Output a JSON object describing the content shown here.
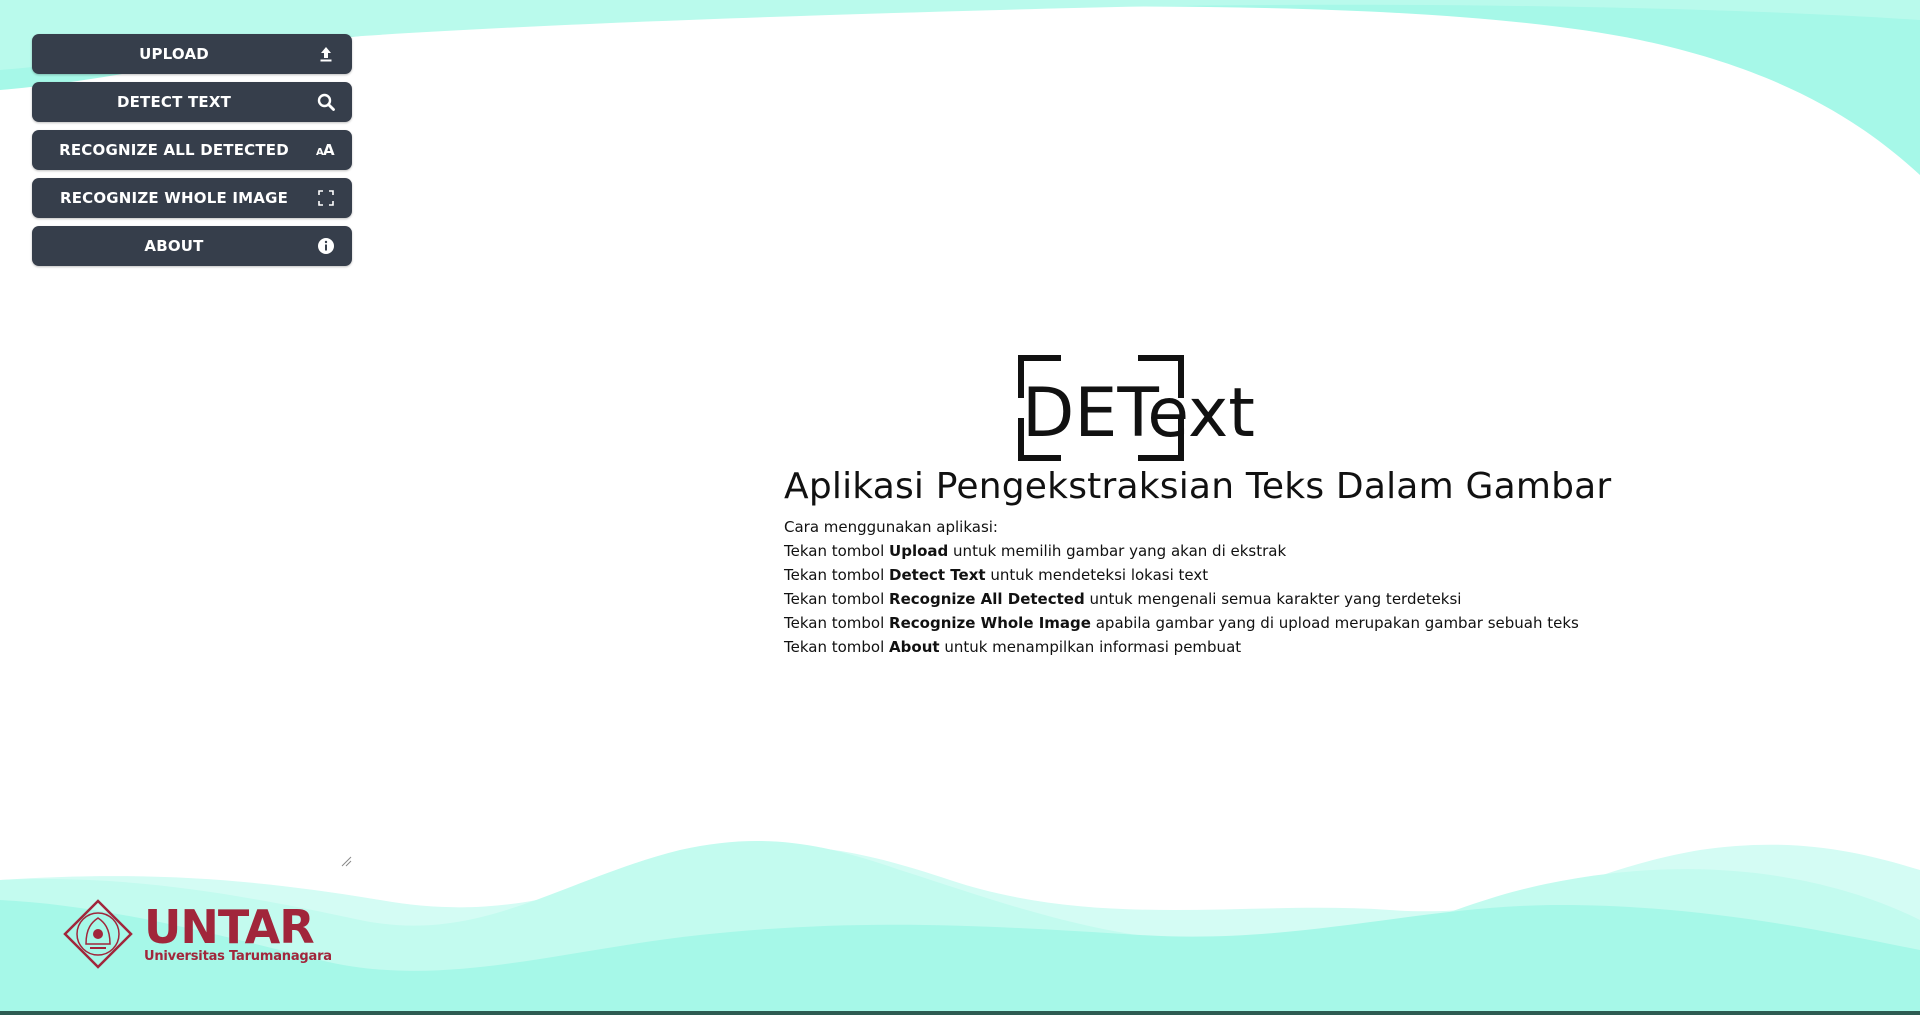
{
  "sidebar": {
    "buttons": [
      {
        "label": "UPLOAD",
        "icon": "upload-icon"
      },
      {
        "label": "DETECT TEXT",
        "icon": "search-icon"
      },
      {
        "label": "RECOGNIZE ALL DETECTED",
        "icon": "font-size-icon"
      },
      {
        "label": "RECOGNIZE WHOLE IMAGE",
        "icon": "fullscreen-icon"
      },
      {
        "label": "ABOUT",
        "icon": "info-icon"
      }
    ]
  },
  "main": {
    "logo_text": "DEText",
    "title": "Aplikasi Pengekstraksian Teks Dalam Gambar",
    "intro": "Cara menggunakan aplikasi:",
    "steps": [
      {
        "prefix": "Tekan tombol ",
        "bold": "Upload",
        "suffix": " untuk memilih gambar yang akan di ekstrak"
      },
      {
        "prefix": "Tekan tombol ",
        "bold": "Detect Text",
        "suffix": " untuk mendeteksi lokasi text"
      },
      {
        "prefix": "Tekan tombol ",
        "bold": "Recognize All Detected",
        "suffix": " untuk mengenali semua karakter yang terdeteksi"
      },
      {
        "prefix": "Tekan tombol ",
        "bold": "Recognize Whole Image",
        "suffix": " apabila gambar yang di upload merupakan gambar sebuah teks"
      },
      {
        "prefix": "Tekan tombol ",
        "bold": "About",
        "suffix": " untuk menampilkan informasi pembuat"
      }
    ]
  },
  "footer": {
    "brand_name": "UNTAR",
    "brand_sub": "Universitas Tarumanagara"
  },
  "colors": {
    "button_bg": "#363e4b",
    "wave_light": "#c8fbf0",
    "wave_mid": "#a6f8e8",
    "brand": "#a1263b"
  }
}
